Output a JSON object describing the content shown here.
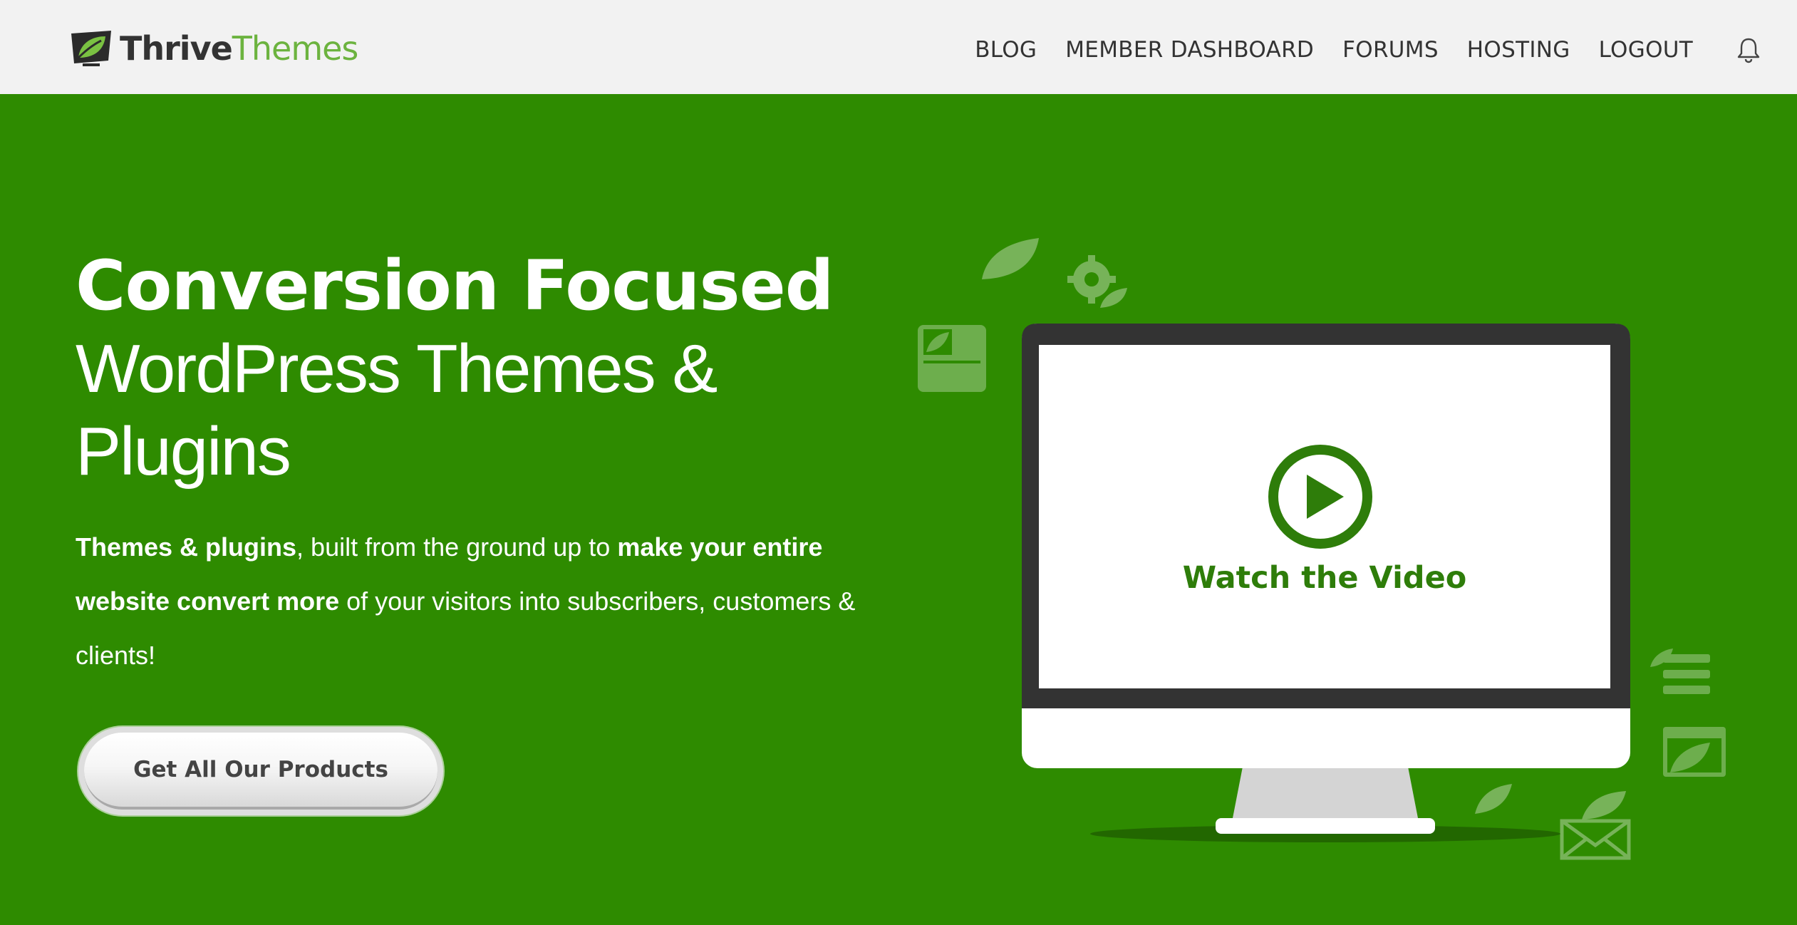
{
  "header": {
    "logo": {
      "part1": "Thrive",
      "part2": "Themes"
    },
    "nav": [
      {
        "label": "BLOG"
      },
      {
        "label": "MEMBER DASHBOARD"
      },
      {
        "label": "FORUMS"
      },
      {
        "label": "HOSTING"
      },
      {
        "label": "LOGOUT"
      }
    ],
    "notification_icon": "bell-icon"
  },
  "hero": {
    "headline_bold": "Conversion Focused",
    "headline_line2": "WordPress Themes &",
    "headline_line3": "Plugins",
    "sub": {
      "part1_bold": "Themes & plugins",
      "part2": ", built from the ground up to ",
      "part3_bold": "make your entire website convert more",
      "part4": " of your visitors into subscribers, customers & clients!"
    },
    "cta_label": "Get All Our Products"
  },
  "video": {
    "label": "Watch the Video",
    "play_icon": "play-icon"
  },
  "colors": {
    "hero_bg": "#2e8b00",
    "brand_green": "#6cb33f",
    "header_bg": "#f2f2f2",
    "video_text": "#2e7d0a"
  }
}
